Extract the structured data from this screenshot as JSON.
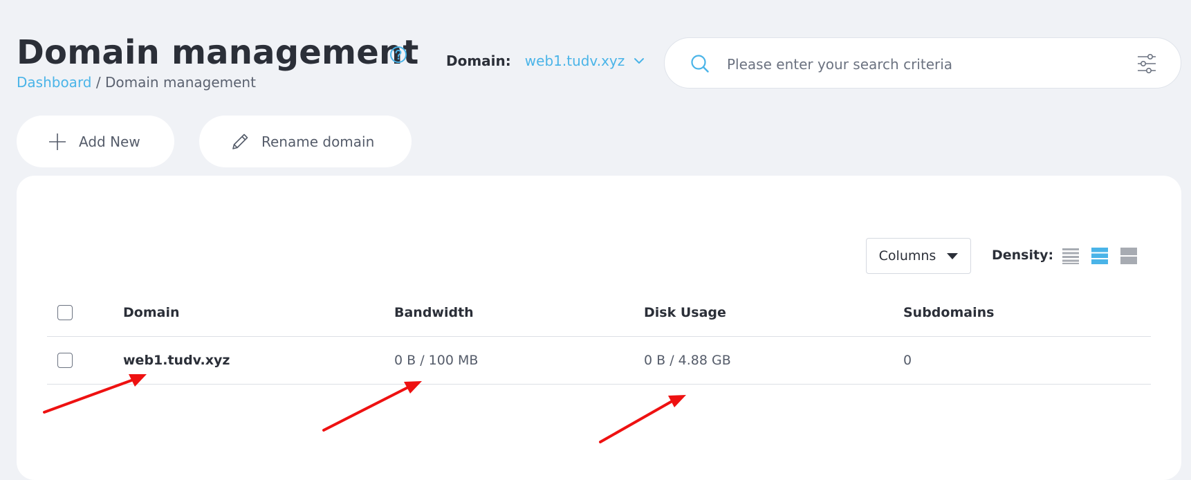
{
  "header": {
    "title": "Domain management",
    "breadcrumb_link": "Dashboard",
    "breadcrumb_separator": "/",
    "breadcrumb_current": "Domain management"
  },
  "domain_selector": {
    "label": "Domain:",
    "value": "web1.tudv.xyz"
  },
  "search": {
    "placeholder": "Please enter your search criteria",
    "value": ""
  },
  "toolbar": {
    "add_label": "Add New",
    "rename_label": "Rename domain"
  },
  "table_controls": {
    "columns_label": "Columns",
    "density_label": "Density:",
    "density_selected": "standard"
  },
  "table": {
    "columns": [
      "Domain",
      "Bandwidth",
      "Disk Usage",
      "Subdomains"
    ],
    "rows": [
      {
        "domain": "web1.tudv.xyz",
        "bandwidth": "0 B / 100 MB",
        "disk_usage": "0 B / 4.88 GB",
        "subdomains": "0"
      }
    ]
  },
  "colors": {
    "accent": "#4ab4e8",
    "annotation_arrow": "#ee1111",
    "background": "#f0f2f6"
  },
  "icons": {
    "help": "question-circle-icon",
    "chevron": "chevron-down-icon",
    "search": "search-icon",
    "filter": "sliders-icon",
    "add": "plus-icon",
    "rename": "pencil-icon"
  }
}
